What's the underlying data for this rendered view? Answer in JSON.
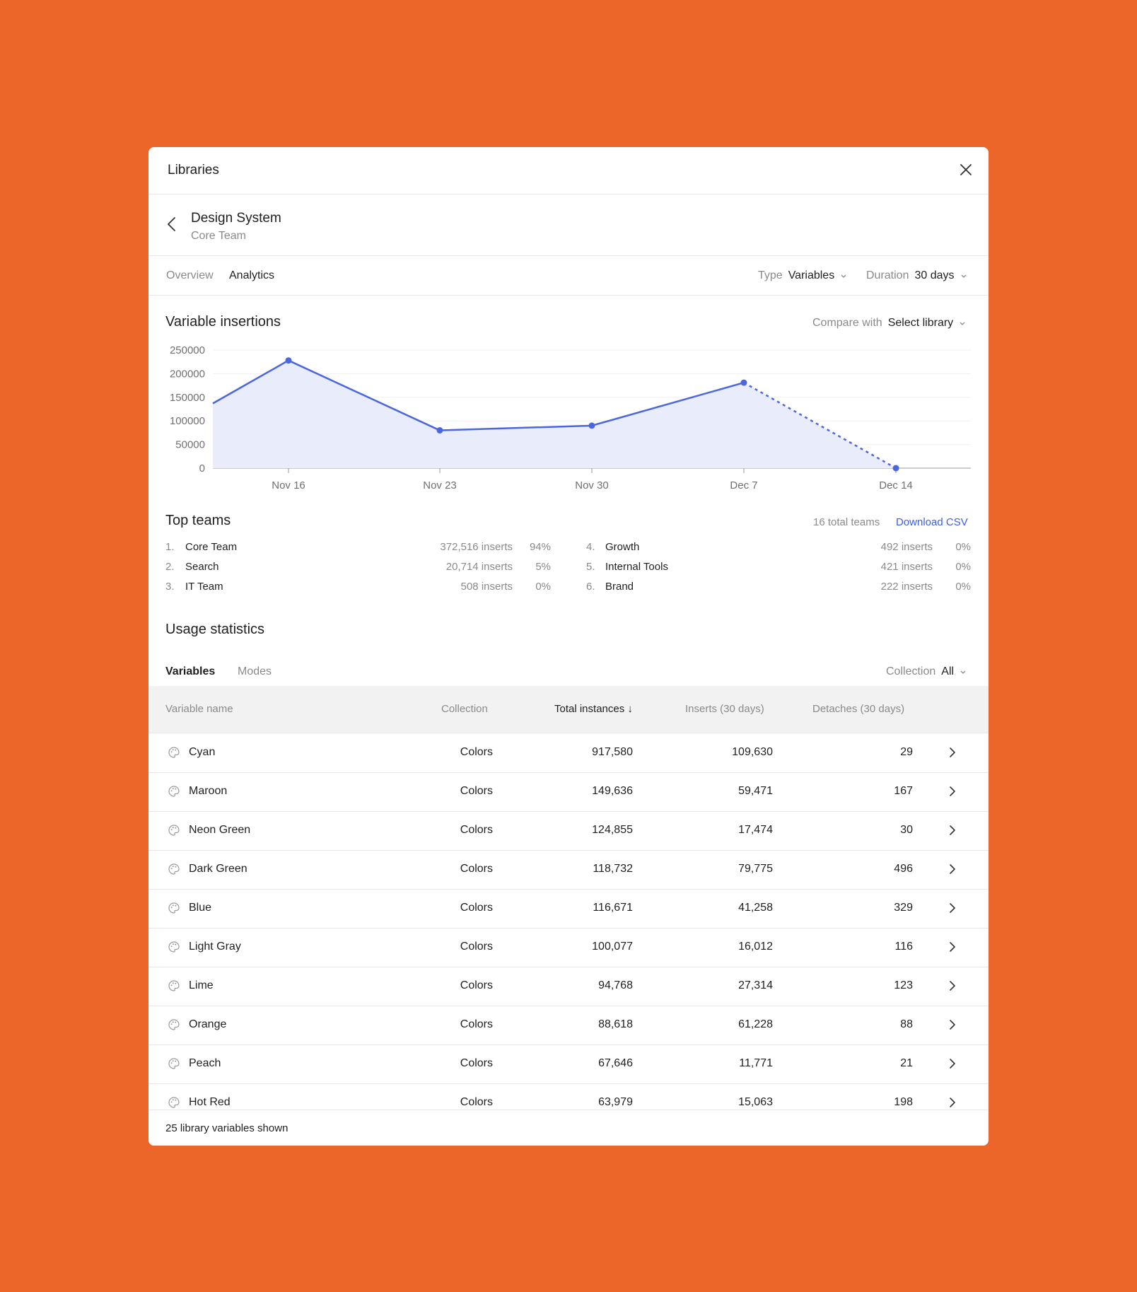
{
  "window": {
    "title": "Libraries"
  },
  "library": {
    "name": "Design System",
    "team": "Core Team"
  },
  "tabs": [
    {
      "label": "Overview"
    },
    {
      "label": "Analytics"
    }
  ],
  "filters": {
    "type": {
      "label": "Type",
      "value": "Variables"
    },
    "duration": {
      "label": "Duration",
      "value": "30 days"
    }
  },
  "insertions": {
    "title": "Variable insertions",
    "compare": {
      "label": "Compare with",
      "value": "Select library"
    }
  },
  "chart_data": {
    "type": "area",
    "x": [
      "Nov 16",
      "Nov 23",
      "Nov 30",
      "Dec 7",
      "Dec 14"
    ],
    "values": [
      228000,
      80000,
      90000,
      181000,
      0
    ],
    "start_value": 137000,
    "projected_segment": [
      "Dec 7",
      "Dec 14"
    ],
    "yticks": [
      0,
      50000,
      100000,
      150000,
      200000,
      250000
    ],
    "ylim": [
      0,
      250000
    ],
    "grid": true,
    "line_color": "#4a67e0",
    "fill_color": "#e9ecfb"
  },
  "top_teams": {
    "title": "Top teams",
    "total": "16 total teams",
    "download": "Download CSV",
    "left": [
      {
        "rank": "1.",
        "name": "Core Team",
        "inserts": "372,516 inserts",
        "pct": "94%"
      },
      {
        "rank": "2.",
        "name": "Search",
        "inserts": "20,714 inserts",
        "pct": "5%"
      },
      {
        "rank": "3.",
        "name": "IT Team",
        "inserts": "508 inserts",
        "pct": "0%"
      }
    ],
    "right": [
      {
        "rank": "4.",
        "name": "Growth",
        "inserts": "492 inserts",
        "pct": "0%"
      },
      {
        "rank": "5.",
        "name": "Internal Tools",
        "inserts": "421 inserts",
        "pct": "0%"
      },
      {
        "rank": "6.",
        "name": "Brand",
        "inserts": "222 inserts",
        "pct": "0%"
      }
    ]
  },
  "usage": {
    "title": "Usage statistics",
    "subtabs": [
      {
        "label": "Variables"
      },
      {
        "label": "Modes"
      }
    ],
    "collection": {
      "label": "Collection",
      "value": "All"
    }
  },
  "table": {
    "headers": {
      "name": "Variable name",
      "collection": "Collection",
      "total": "Total instances ↓",
      "inserts": "Inserts (30 days)",
      "detaches": "Detaches (30 days)"
    },
    "rows": [
      {
        "name": "Cyan",
        "collection": "Colors",
        "total": "917,580",
        "inserts": "109,630",
        "detaches": "29"
      },
      {
        "name": "Maroon",
        "collection": "Colors",
        "total": "149,636",
        "inserts": "59,471",
        "detaches": "167"
      },
      {
        "name": "Neon Green",
        "collection": "Colors",
        "total": "124,855",
        "inserts": "17,474",
        "detaches": "30"
      },
      {
        "name": "Dark Green",
        "collection": "Colors",
        "total": "118,732",
        "inserts": "79,775",
        "detaches": "496"
      },
      {
        "name": "Blue",
        "collection": "Colors",
        "total": "116,671",
        "inserts": "41,258",
        "detaches": "329"
      },
      {
        "name": "Light Gray",
        "collection": "Colors",
        "total": "100,077",
        "inserts": "16,012",
        "detaches": "116"
      },
      {
        "name": "Lime",
        "collection": "Colors",
        "total": "94,768",
        "inserts": "27,314",
        "detaches": "123"
      },
      {
        "name": "Orange",
        "collection": "Colors",
        "total": "88,618",
        "inserts": "61,228",
        "detaches": "88"
      },
      {
        "name": "Peach",
        "collection": "Colors",
        "total": "67,646",
        "inserts": "11,771",
        "detaches": "21"
      },
      {
        "name": "Hot Red",
        "collection": "Colors",
        "total": "63,979",
        "inserts": "15,063",
        "detaches": "198"
      }
    ],
    "footer": "25 library variables shown"
  },
  "icons": {
    "close": "close-icon",
    "back": "chevron-left-icon",
    "dropdown": "chevron-down-icon",
    "variable": "palette-icon",
    "row_action": "chevron-right-icon"
  }
}
